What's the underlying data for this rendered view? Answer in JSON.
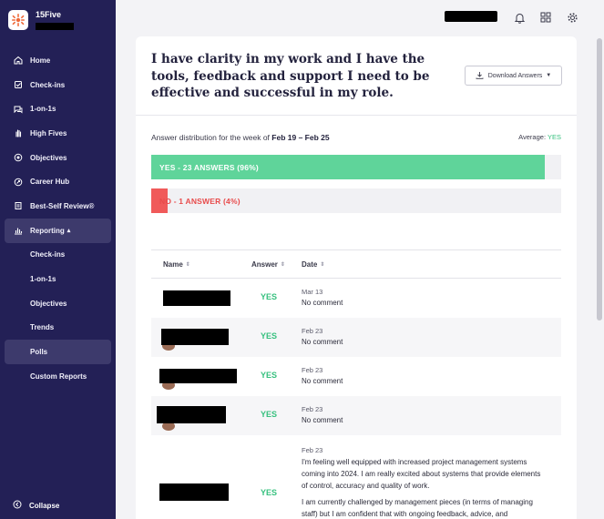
{
  "brand": {
    "name": "15Five"
  },
  "sidebar": {
    "items": [
      {
        "label": "Home",
        "icon": "home-icon"
      },
      {
        "label": "Check-ins",
        "icon": "checkin-icon"
      },
      {
        "label": "1-on-1s",
        "icon": "chat-icon"
      },
      {
        "label": "High Fives",
        "icon": "high-five-icon"
      },
      {
        "label": "Objectives",
        "icon": "target-icon"
      },
      {
        "label": "Career Hub",
        "icon": "career-icon"
      },
      {
        "label": "Best-Self Review®",
        "icon": "review-icon"
      },
      {
        "label": "Reporting",
        "icon": "chart-icon",
        "caret": "▴"
      }
    ],
    "sub_items": [
      {
        "label": "Check-ins"
      },
      {
        "label": "1-on-1s"
      },
      {
        "label": "Objectives"
      },
      {
        "label": "Trends"
      },
      {
        "label": "Polls"
      },
      {
        "label": "Custom Reports"
      }
    ],
    "collapse_label": "Collapse"
  },
  "topbar": {
    "icons": [
      "bell-icon",
      "grid-icon",
      "gear-icon"
    ]
  },
  "question": {
    "title": "I have clarity in my work and I have the tools, feedback and support I need to be effective and successful in my role.",
    "download_label": "Download Answers"
  },
  "distribution": {
    "label_prefix": "Answer distribution for the week of ",
    "week": "Feb 19 – Feb 25",
    "average_label": "Average:",
    "average_value": "YES",
    "bars": [
      {
        "label": "YES  -  23 ANSWERS (96%)",
        "fraction": 0.96,
        "color": "#5fd49a",
        "text_color": "#ffffff"
      },
      {
        "label": "NO  -  1 ANSWER (4%)",
        "fraction": 0.04,
        "color": "#f05a5a",
        "text_color": "#e84b4b"
      }
    ]
  },
  "table": {
    "headers": [
      "Name",
      "Answer",
      "Date"
    ],
    "rows": [
      {
        "answer": "YES",
        "date": "Mar 13",
        "comment": "No comment"
      },
      {
        "answer": "YES",
        "date": "Feb 23",
        "comment": "No comment"
      },
      {
        "answer": "YES",
        "date": "Feb 23",
        "comment": "No comment"
      },
      {
        "answer": "YES",
        "date": "Feb 23",
        "comment": "No comment"
      },
      {
        "answer": "YES",
        "date": "Feb 23",
        "comment": "I'm feeling well equipped with increased project management systems coming into 2024. I am really excited about systems that provide elements of control, accuracy and quality of work.",
        "comment2": "I am currently challenged by management pieces (in terms of managing staff) but I am confident that with ongoing feedback, advice, and"
      }
    ]
  }
}
